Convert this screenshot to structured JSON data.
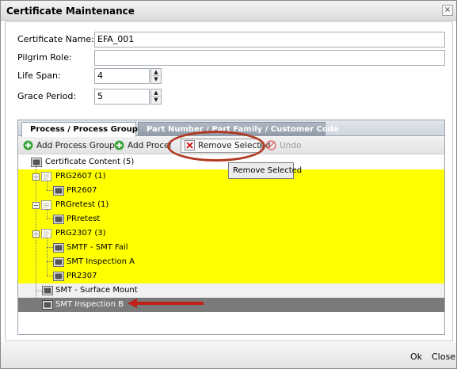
{
  "window": {
    "title": "Certificate Maintenance",
    "close_glyph": "×"
  },
  "form": {
    "certificate_name": {
      "label": "Certificate Name:",
      "value": "EFA_001"
    },
    "pilgrim_role": {
      "label": "Pilgrim Role:",
      "value": ""
    },
    "life_span": {
      "label": "Life Span:",
      "value": "4"
    },
    "grace_period": {
      "label": "Grace Period:",
      "value": "5"
    }
  },
  "tabs": [
    {
      "label": "Process / Process Group",
      "active": true
    },
    {
      "label": "Part Number / Part Family / Customer Code",
      "active": false
    }
  ],
  "toolbar": {
    "add_process_group": "Add Process Group",
    "add_process": "Add Process",
    "remove_selected": "Remove Selected",
    "undo": "Undo"
  },
  "tooltip": {
    "text": "Remove Selected"
  },
  "tree": {
    "root": "Certificate Content (5)",
    "items": [
      {
        "label": "PRG2607 (1)",
        "kind": "group",
        "highlight": "yellow"
      },
      {
        "label": "PR2607",
        "kind": "process",
        "highlight": "yellow"
      },
      {
        "label": "PRGretest (1)",
        "kind": "group",
        "highlight": "yellow"
      },
      {
        "label": "PRretest",
        "kind": "process",
        "highlight": "yellow"
      },
      {
        "label": "PRG2307 (3)",
        "kind": "group",
        "highlight": "yellow"
      },
      {
        "label": "SMTF - SMT Fail",
        "kind": "process",
        "highlight": "yellow"
      },
      {
        "label": "SMT Inspection A",
        "kind": "process",
        "highlight": "yellow"
      },
      {
        "label": "PR2307",
        "kind": "process",
        "highlight": "yellow"
      },
      {
        "label": "SMT - Surface Mount",
        "kind": "process",
        "highlight": "gray"
      },
      {
        "label": "SMT Inspection B",
        "kind": "process",
        "highlight": "selected"
      }
    ]
  },
  "footer": {
    "ok": "Ok",
    "close": "Close"
  },
  "colors": {
    "highlight_yellow": "#ffff00",
    "selected_row": "#7a7a7a",
    "annotation_red": "#b23a22"
  }
}
